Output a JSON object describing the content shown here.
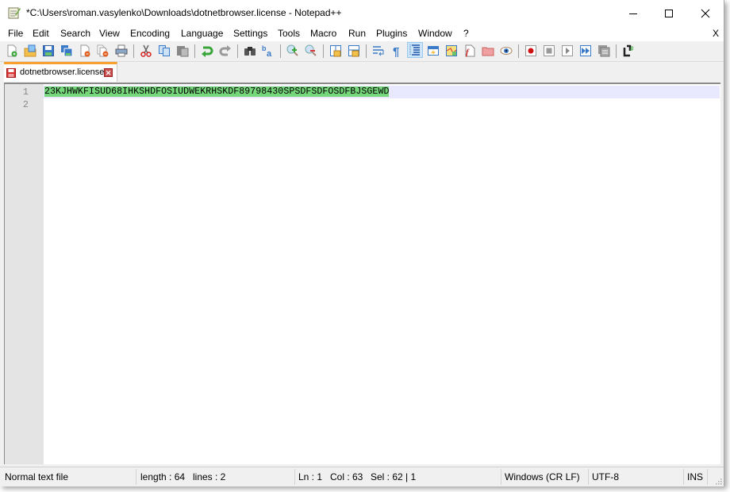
{
  "window": {
    "title": "*C:\\Users\\roman.vasylenko\\Downloads\\dotnetbrowser.license - Notepad++",
    "app_icon": "notepad-plus-plus-icon",
    "controls": [
      "minimize",
      "maximize",
      "close"
    ]
  },
  "menu": {
    "items": [
      "File",
      "Edit",
      "Search",
      "View",
      "Encoding",
      "Language",
      "Settings",
      "Tools",
      "Macro",
      "Run",
      "Plugins",
      "Window",
      "?"
    ],
    "close_label": "X"
  },
  "toolbar": {
    "buttons": [
      "new-file",
      "open-file",
      "save",
      "save-all",
      "close",
      "close-all",
      "print",
      "cut",
      "copy",
      "paste",
      "undo",
      "redo",
      "find",
      "replace",
      "zoom-in",
      "zoom-out",
      "sync-vertical-scroll",
      "sync-horizontal-scroll",
      "word-wrap",
      "show-all-characters",
      "indent-guide",
      "user-defined-language",
      "document-map",
      "function-list",
      "folder-as-workspace",
      "monitoring",
      "start-recording",
      "stop-recording",
      "playback",
      "run-macro-multiple",
      "save-macro",
      "plugin-admin"
    ],
    "active": "indent-guide"
  },
  "tabs": [
    {
      "label": "dotnetbrowser.license",
      "modified": true,
      "active": true
    }
  ],
  "editor": {
    "lines": [
      {
        "number": "1",
        "text": "23KJHWKFISUD68IHKSHDFOSIUDWEKRHSKDF89798430SPSDFSDFOSDFBJSGEWD"
      },
      {
        "number": "2",
        "text": ""
      }
    ],
    "selection_color": "#76d77a",
    "current_line_color": "#e8e8ff"
  },
  "status": {
    "file_type": "Normal text file",
    "length": "length : 64",
    "lines": "lines : 2",
    "ln": "Ln : 1",
    "col": "Col : 63",
    "sel": "Sel : 62 | 1",
    "eol": "Windows (CR LF)",
    "encoding": "UTF-8",
    "mode": "INS"
  }
}
